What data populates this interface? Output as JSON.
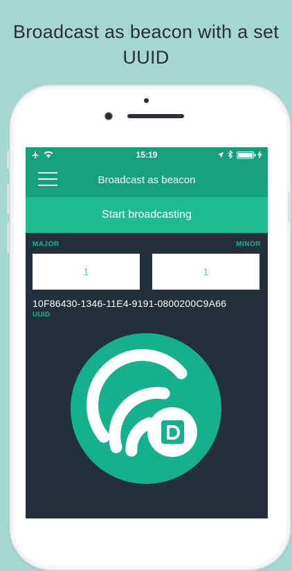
{
  "headline": {
    "line1": "Broadcast as beacon with a set",
    "line2": "UUID"
  },
  "status_bar": {
    "time": "15:19",
    "left_icons": [
      "airplane-icon",
      "wifi-icon"
    ],
    "right_icons": [
      "location-arrow-icon",
      "bluetooth-icon",
      "battery-icon",
      "charging-bolt-icon"
    ]
  },
  "nav": {
    "title": "Broadcast as beacon",
    "menu_icon": "hamburger-icon"
  },
  "start_button": {
    "label": "Start broadcasting"
  },
  "fields": {
    "major_label": "MAJOR",
    "minor_label": "MINOR",
    "major_value": "1",
    "minor_value": "1"
  },
  "uuid": {
    "value": "10F86430-1346-11E4-9191-0800200C9A66",
    "label": "UUID"
  },
  "colors": {
    "background": "#a3d7d0",
    "nav_green": "#16a07b",
    "button_green": "#1fbb91",
    "accent_green": "#19b38a",
    "screen_dark": "#22303c"
  },
  "illustration": "beacon-broadcast-icon"
}
